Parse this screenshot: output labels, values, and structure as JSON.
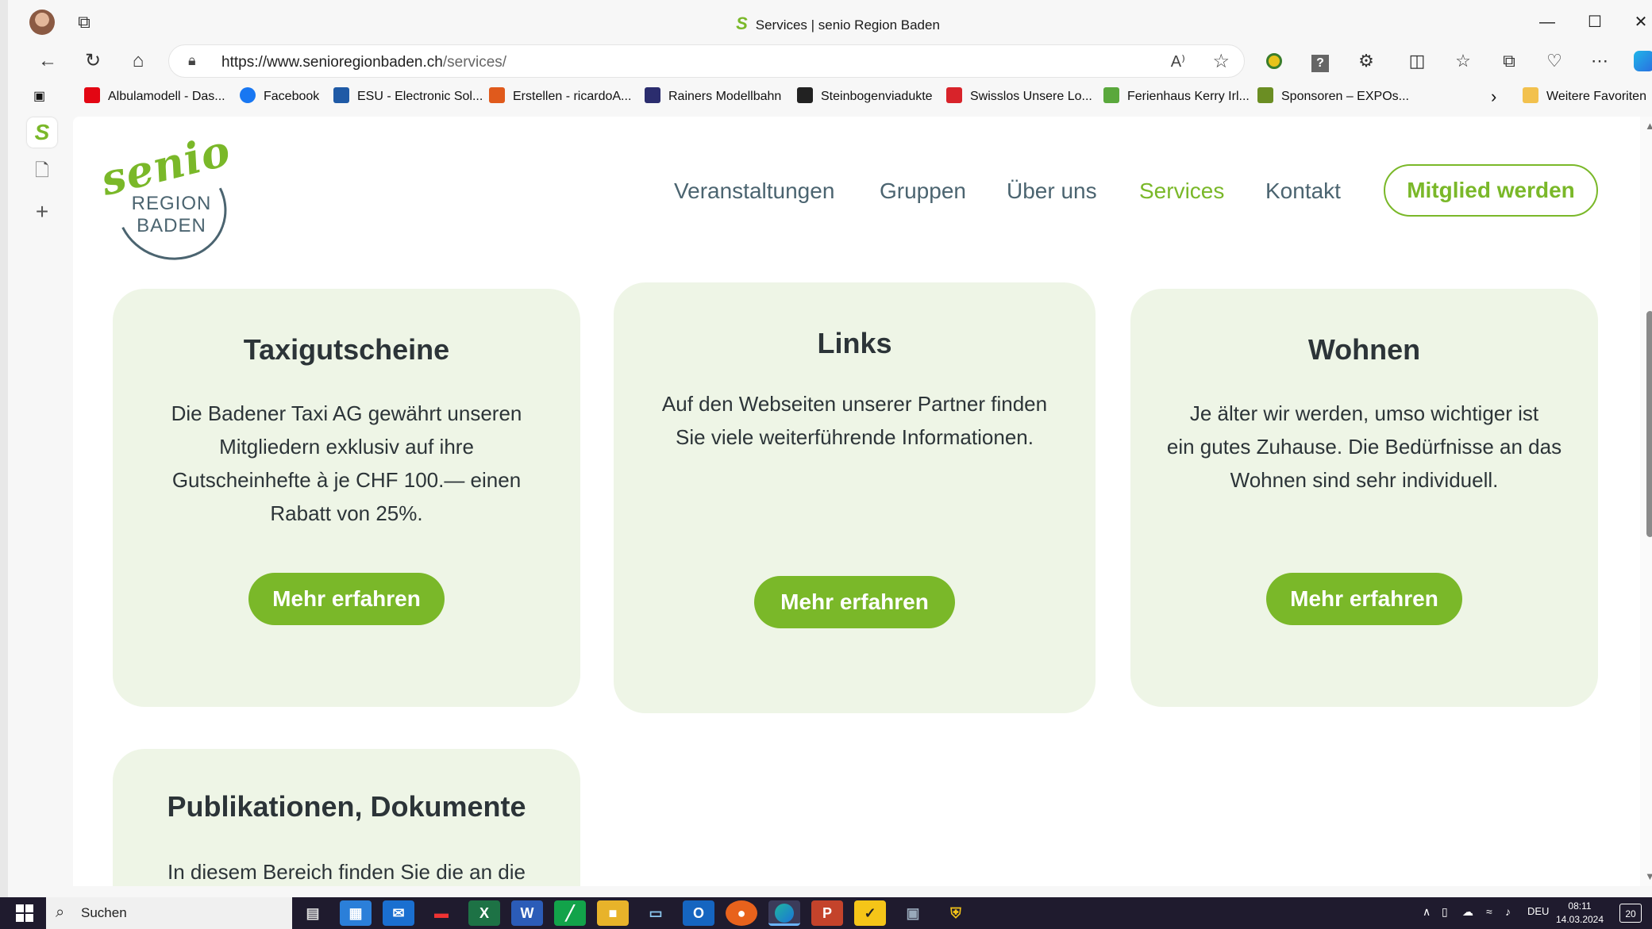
{
  "browser": {
    "title": "Services | senio Region Baden",
    "url_host": "https://www.senioregionbaden.ch",
    "url_path": "/services/",
    "read_aloud": "A⁾",
    "controls": {
      "minimize": "—",
      "maximize": "☐",
      "close": "✕"
    }
  },
  "favorites": [
    {
      "label": "Albulamodell - Das...",
      "color": "#e30613"
    },
    {
      "label": "Facebook",
      "color": "#1877f2"
    },
    {
      "label": "ESU - Electronic Sol...",
      "color": "#1f5aa6"
    },
    {
      "label": "Erstellen - ricardoA...",
      "color": "#e05a1c"
    },
    {
      "label": "Rainers Modellbahn",
      "color": "#2b2d6e"
    },
    {
      "label": "Steinbogenviadukte",
      "color": "#222222"
    },
    {
      "label": "Swisslos  Unsere Lo...",
      "color": "#d8232a"
    },
    {
      "label": "Ferienhaus Kerry Irl...",
      "color": "#5aa83c"
    },
    {
      "label": "Sponsoren – EXPOs...",
      "color": "#6b8e23"
    }
  ],
  "favorites_more": "›",
  "favorites_folder": "Weitere Favoriten",
  "site": {
    "logo_word": "senio",
    "logo_line1": "REGION",
    "logo_line2": "BADEN",
    "nav": [
      "Veranstaltungen",
      "Gruppen",
      "Über uns",
      "Services",
      "Kontakt"
    ],
    "nav_active": "Services",
    "cta": "Mitglied werden",
    "brand_green": "#7ab829",
    "brand_slate": "#4b6470",
    "card_bg": "#eef5e6"
  },
  "cards": [
    {
      "title": "Taxigutscheine",
      "lines": [
        "Die Badener Taxi AG gewährt unseren",
        "Mitgliedern exklusiv auf ihre",
        "Gutscheinhefte à je CHF 100.— einen",
        "Rabatt von 25%."
      ],
      "button": "Mehr erfahren"
    },
    {
      "title": "Links",
      "lines": [
        "Auf den Webseiten unserer Partner finden",
        "Sie viele weiterführende Informationen."
      ],
      "button": "Mehr erfahren"
    },
    {
      "title": "Wohnen",
      "lines": [
        "Je älter wir werden, umso wichtiger ist",
        "ein gutes Zuhause. Die Bedürfnisse an das",
        "Wohnen sind sehr individuell."
      ],
      "button": "Mehr erfahren"
    },
    {
      "title": "Publikationen, Dokumente",
      "lines": [
        "In diesem Bereich finden Sie die an die"
      ],
      "button": ""
    }
  ],
  "taskbar": {
    "search": "Suchen",
    "lang": "DEU",
    "time": "08:11",
    "date": "14.03.2024",
    "notifications": "20"
  }
}
